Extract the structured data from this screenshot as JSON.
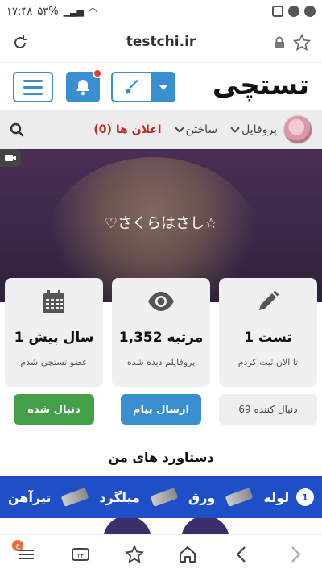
{
  "status_bar": {
    "time": "۱۷:۴۸",
    "battery": "۵۳%"
  },
  "browser": {
    "url": "testchi.ir"
  },
  "site": {
    "logo": "تستچی",
    "brand_color": "#3a8fd0",
    "notification_color": "#e53935"
  },
  "nav": {
    "profile_label": "پروفایل",
    "create_label": "ساختن",
    "ads_label": "اعلان ها (0)"
  },
  "cover": {
    "title": "♡さくらはさし☆"
  },
  "stats": [
    {
      "icon": "pencil-icon",
      "value": "1 تست",
      "caption": "تا الان ثبت کردم"
    },
    {
      "icon": "eye-icon",
      "value": "1,352 مرتبه",
      "caption": "پروفایلم دیده شده"
    },
    {
      "icon": "calendar-icon",
      "value": "1 سال پیش",
      "caption": "عضو تستچی شدم"
    }
  ],
  "actions": {
    "follow_label": "دنبال شده",
    "message_label": "ارسال پیام",
    "followers_label": "69 دنبال کننده"
  },
  "achievements": {
    "title": "دستاورد های من"
  },
  "ad": {
    "number": "1",
    "items": [
      "لوله",
      "ورق",
      "میلگرد",
      "تیرآهن"
    ]
  },
  "bottom_nav": {
    "menu_badge": "ج"
  }
}
